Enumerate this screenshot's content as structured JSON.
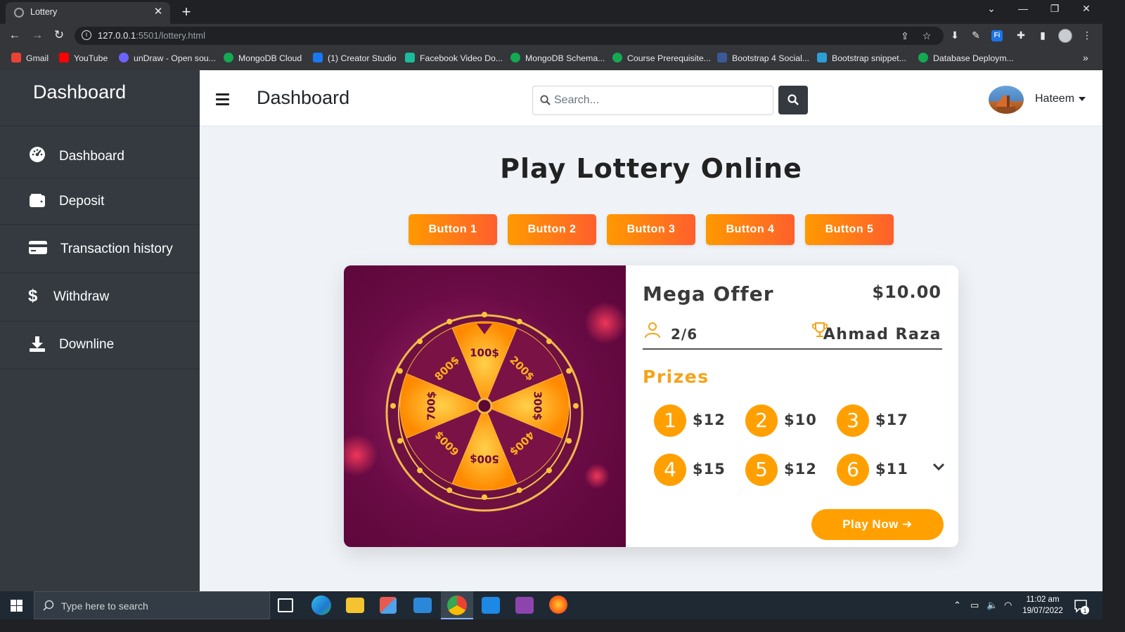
{
  "browser": {
    "tab_title": "Lottery",
    "tab_close": "✕",
    "new_tab": "+",
    "url_host": "127.0.0.1",
    "url_rest": ":5501/lottery.html",
    "window_controls": [
      "⌄",
      "—",
      "❐",
      "✕"
    ],
    "bookmarks": [
      {
        "label": "Gmail",
        "color": "#ea4335"
      },
      {
        "label": "YouTube",
        "color": "#ff0000"
      },
      {
        "label": "unDraw - Open sou...",
        "color": "#6c63ff"
      },
      {
        "label": "MongoDB Cloud",
        "color": "#13aa52"
      },
      {
        "label": "(1) Creator Studio",
        "color": "#1877f2"
      },
      {
        "label": "Facebook Video Do...",
        "color": "#1abc9c"
      },
      {
        "label": "MongoDB Schema...",
        "color": "#13aa52"
      },
      {
        "label": "Course Prerequisite...",
        "color": "#13aa52"
      },
      {
        "label": "Bootstrap 4 Social...",
        "color": "#3b5998"
      },
      {
        "label": "Bootstrap snippet...",
        "color": "#2a9fd6"
      },
      {
        "label": "Database Deploym...",
        "color": "#13aa52"
      }
    ],
    "bookmarks_more": "»"
  },
  "sidebar": {
    "brand": "Dashboard",
    "items": [
      {
        "label": "Dashboard",
        "icon": "tachometer-icon"
      },
      {
        "label": "Deposit",
        "icon": "wallet-icon"
      },
      {
        "label": "Transaction history",
        "icon": "credit-card-icon"
      },
      {
        "label": "Withdraw",
        "icon": "dollar-icon"
      },
      {
        "label": "Downline",
        "icon": "download-icon"
      }
    ]
  },
  "topnav": {
    "title": "Dashboard",
    "search_placeholder": "Search...",
    "user_name": "Hateem"
  },
  "main": {
    "title": "Play Lottery Online",
    "buttons": [
      "Button 1",
      "Button 2",
      "Button 3",
      "Button 4",
      "Button 5"
    ],
    "card": {
      "wheel_labels": [
        "100$",
        "200$",
        "300$",
        "400$",
        "500$",
        "600$",
        "700$",
        "800$"
      ],
      "offer_title": "Mega Offer",
      "price": "$10.00",
      "participants": "2/6",
      "winner": "Ahmad Raza",
      "prizes_title": "Prizes",
      "prizes": [
        {
          "rank": "1",
          "amount": "$12"
        },
        {
          "rank": "2",
          "amount": "$10"
        },
        {
          "rank": "3",
          "amount": "$17"
        },
        {
          "rank": "4",
          "amount": "$15"
        },
        {
          "rank": "5",
          "amount": "$12"
        },
        {
          "rank": "6",
          "amount": "$11"
        }
      ],
      "play_button": "Play Now ➔"
    }
  },
  "taskbar": {
    "search_text": "Type here to search",
    "time": "11:02 am",
    "date": "19/07/2022",
    "notification_count": "1"
  },
  "colors": {
    "accent_orange": "#ffa000",
    "button_gradient_start": "#ff9900",
    "button_gradient_end": "#ff5f2c",
    "sidebar_bg": "#343a40",
    "page_bg": "#eff2f6"
  }
}
